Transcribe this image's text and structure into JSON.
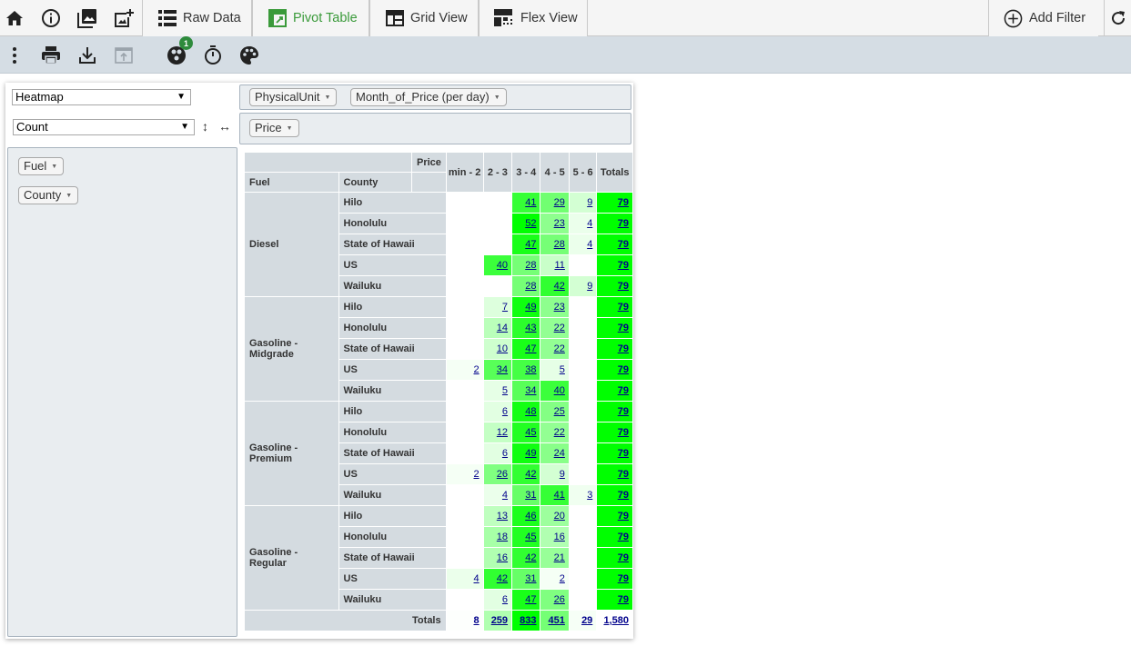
{
  "tabs": {
    "raw_data": "Raw Data",
    "pivot_table": "Pivot Table",
    "grid_view": "Grid View",
    "flex_view": "Flex View",
    "add_filter": "Add Filter"
  },
  "toolbar": {
    "badge_count": "1"
  },
  "pivot": {
    "renderer": "Heatmap",
    "aggregator": "Count",
    "col_fields": [
      "PhysicalUnit",
      "Month_of_Price (per day)"
    ],
    "val_fields": [
      "Price"
    ],
    "row_fields": [
      "Fuel",
      "County"
    ]
  },
  "table": {
    "corner_label": "Price",
    "row_header_labels": [
      "Fuel",
      "County"
    ],
    "columns": [
      "min - 2",
      "2 - 3",
      "3 - 4",
      "4 - 5",
      "5 - 6"
    ],
    "totals_label": "Totals",
    "groups": [
      {
        "fuel": "Diesel",
        "rows": [
          {
            "county": "Hilo",
            "cells": [
              "",
              "",
              "41",
              "29",
              "9"
            ],
            "total": "79"
          },
          {
            "county": "Honolulu",
            "cells": [
              "",
              "",
              "52",
              "23",
              "4"
            ],
            "total": "79"
          },
          {
            "county": "State of Hawaii",
            "cells": [
              "",
              "",
              "47",
              "28",
              "4"
            ],
            "total": "79"
          },
          {
            "county": "US",
            "cells": [
              "",
              "40",
              "28",
              "11",
              ""
            ],
            "total": "79"
          },
          {
            "county": "Wailuku",
            "cells": [
              "",
              "",
              "28",
              "42",
              "9"
            ],
            "total": "79"
          }
        ]
      },
      {
        "fuel": "Gasoline - Midgrade",
        "rows": [
          {
            "county": "Hilo",
            "cells": [
              "",
              "7",
              "49",
              "23",
              ""
            ],
            "total": "79"
          },
          {
            "county": "Honolulu",
            "cells": [
              "",
              "14",
              "43",
              "22",
              ""
            ],
            "total": "79"
          },
          {
            "county": "State of Hawaii",
            "cells": [
              "",
              "10",
              "47",
              "22",
              ""
            ],
            "total": "79"
          },
          {
            "county": "US",
            "cells": [
              "2",
              "34",
              "38",
              "5",
              ""
            ],
            "total": "79"
          },
          {
            "county": "Wailuku",
            "cells": [
              "",
              "5",
              "34",
              "40",
              ""
            ],
            "total": "79"
          }
        ]
      },
      {
        "fuel": "Gasoline - Premium",
        "rows": [
          {
            "county": "Hilo",
            "cells": [
              "",
              "6",
              "48",
              "25",
              ""
            ],
            "total": "79"
          },
          {
            "county": "Honolulu",
            "cells": [
              "",
              "12",
              "45",
              "22",
              ""
            ],
            "total": "79"
          },
          {
            "county": "State of Hawaii",
            "cells": [
              "",
              "6",
              "49",
              "24",
              ""
            ],
            "total": "79"
          },
          {
            "county": "US",
            "cells": [
              "2",
              "26",
              "42",
              "9",
              ""
            ],
            "total": "79"
          },
          {
            "county": "Wailuku",
            "cells": [
              "",
              "4",
              "31",
              "41",
              "3"
            ],
            "total": "79"
          }
        ]
      },
      {
        "fuel": "Gasoline - Regular",
        "rows": [
          {
            "county": "Hilo",
            "cells": [
              "",
              "13",
              "46",
              "20",
              ""
            ],
            "total": "79"
          },
          {
            "county": "Honolulu",
            "cells": [
              "",
              "18",
              "45",
              "16",
              ""
            ],
            "total": "79"
          },
          {
            "county": "State of Hawaii",
            "cells": [
              "",
              "16",
              "42",
              "21",
              ""
            ],
            "total": "79"
          },
          {
            "county": "US",
            "cells": [
              "4",
              "42",
              "31",
              "2",
              ""
            ],
            "total": "79"
          },
          {
            "county": "Wailuku",
            "cells": [
              "",
              "6",
              "47",
              "26",
              ""
            ],
            "total": "79"
          }
        ]
      }
    ],
    "col_totals": [
      "8",
      "259",
      "833",
      "451",
      "29"
    ],
    "grand_total": "1,580"
  },
  "colors": {
    "accent_green": "#3a9a3a",
    "heatmap_max": "#00ff00",
    "link": "#00008b",
    "header_bg": "#d4dbe0",
    "toolbar_bg": "#d5dde4"
  }
}
